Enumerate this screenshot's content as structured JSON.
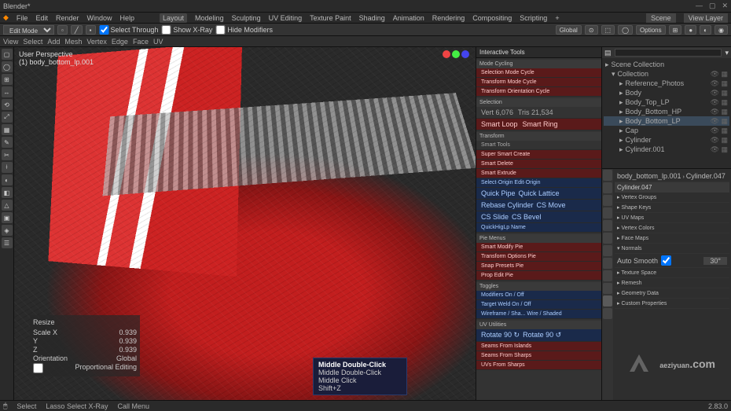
{
  "title": "Blender*",
  "top_menu": [
    "File",
    "Edit",
    "Render",
    "Window",
    "Help"
  ],
  "workspaces": [
    "Layout",
    "Modeling",
    "Sculpting",
    "UV Editing",
    "Texture Paint",
    "Shading",
    "Animation",
    "Rendering",
    "Compositing",
    "Scripting",
    "+"
  ],
  "header": {
    "mode": "Edit Mode",
    "view": "View",
    "select": "Select",
    "add": "Add",
    "mesh": "Mesh",
    "vertex": "Vertex",
    "edge": "Edge",
    "face": "Face",
    "uv": "UV",
    "select_through": "Select Through",
    "show_xray": "Show X-Ray",
    "hide_modifiers": "Hide Modifiers",
    "orientation": "Global",
    "pivot": "Median",
    "snap": "Snap",
    "proportional": "Proportional Editing",
    "options": "Options"
  },
  "viewport_info": {
    "line1": "User Perspective",
    "line2": "(1) body_bottom_lp.001"
  },
  "left_tools": [
    "▢",
    "◯",
    "⊞",
    "↔",
    "⟲",
    "⤢",
    "▦",
    "✎",
    "✂",
    "⟊",
    "◐",
    "◧",
    "△",
    "▣",
    "◈",
    "☰"
  ],
  "resize_panel": {
    "title": "Resize",
    "scale_x": {
      "label": "Scale X",
      "value": "0.939"
    },
    "scale_y": {
      "label": "Y",
      "value": "0.939"
    },
    "scale_z": {
      "label": "Z",
      "value": "0.939"
    },
    "orientation_label": "Orientation",
    "orientation_value": "Global",
    "prop_label": "Proportional Editing"
  },
  "tooltip": {
    "title": "Middle Double-Click",
    "line1": "Middle Double-Click",
    "line2": "Middle Click",
    "line3": "Shift+Z"
  },
  "n_panel": {
    "header": "Interactive Tools",
    "sect1": "Mode Cycling",
    "items1": [
      "Selection Mode Cycle",
      "Transform Mode Cycle",
      "Transform Orientation Cycle"
    ],
    "sect2": "Selection",
    "items2_row": [
      "Vert 6,076",
      "Tris 21,534"
    ],
    "items2": [
      "Smart Loop",
      "Smart Ring"
    ],
    "sect3": "Transform",
    "items3": [
      "Smart Tools",
      "Super Smart Create",
      "Smart Delete",
      "Smart Extrude"
    ],
    "sect4": "Select·Origin   Edit·Origin",
    "items4_cols": [
      [
        "Quick Pipe",
        "Rebase Cylinder",
        "CS Slide",
        "QuickHigLp Name"
      ],
      [
        "Quick Lattice",
        "CS Move",
        "CS Bevel",
        ""
      ]
    ],
    "sect5": "Pie Menus",
    "items5": [
      "Smart Modify Pie",
      "Transform Options Pie",
      "Snap Presets Pie",
      "Prop Edit Pie"
    ],
    "sect6": "Toggles",
    "items6": [
      "Modifiers On / Off",
      "Target Weld On / Off",
      "Wireframe / Sha...  Wire / Shaded"
    ],
    "sect7": "UV Utilities",
    "uv_row": [
      "Rotate 90 ↻",
      "Rotate 90 ↺"
    ],
    "items7": [
      "Seams From Islands",
      "Seams From Sharps",
      "UVs From Sharps"
    ]
  },
  "scene_dropdown": "Scene",
  "viewlayer": "View Layer",
  "outliner": {
    "root": "Scene Collection",
    "items": [
      {
        "name": "Collection",
        "depth": 1,
        "expanded": true
      },
      {
        "name": "Reference_Photos",
        "depth": 2
      },
      {
        "name": "Body",
        "depth": 2
      },
      {
        "name": "Body_Top_LP",
        "depth": 2
      },
      {
        "name": "Body_Bottom_HP",
        "depth": 2
      },
      {
        "name": "Body_Bottom_LP",
        "depth": 2,
        "sel": true
      },
      {
        "name": "Cap",
        "depth": 2
      },
      {
        "name": "Cylinder",
        "depth": 2
      },
      {
        "name": "Cylinder.001",
        "depth": 2
      }
    ]
  },
  "props": {
    "breadcrumb1": "body_bottom_lp.001",
    "breadcrumb2": "Cylinder.047",
    "object_label": "Cylinder.047",
    "sections": [
      "Vertex Groups",
      "Shape Keys",
      "UV Maps",
      "Vertex Colors",
      "Face Maps",
      "Normals"
    ],
    "auto_smooth_label": "Auto Smooth",
    "auto_smooth_value": "30°",
    "footer_sections": [
      "Texture Space",
      "Remesh",
      "Geometry Data",
      "Custom Properties"
    ]
  },
  "statusbar": {
    "left_items": [
      "Select",
      "Lasso Select X-Ray",
      "Call Menu"
    ],
    "right": "2.83.0"
  },
  "watermark": "aeziyuan",
  "watermark_sub": ".com"
}
